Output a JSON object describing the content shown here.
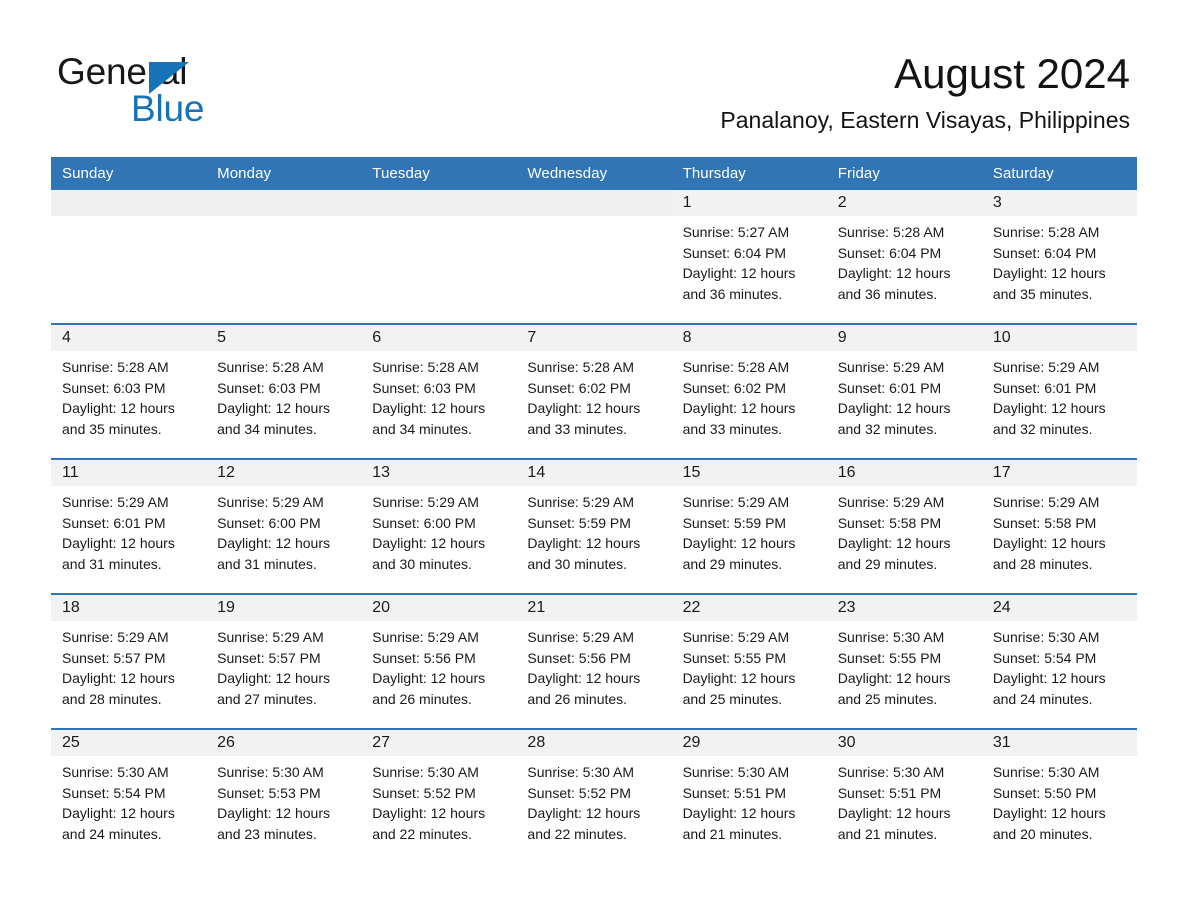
{
  "brand": {
    "name_part1": "General",
    "name_part2": "Blue",
    "flag_icon": "triangle-flag-icon",
    "accent_color": "#1773b8"
  },
  "header": {
    "month_title": "August 2024",
    "location": "Panalanoy, Eastern Visayas, Philippines"
  },
  "theme": {
    "header_blue": "#3275b4",
    "date_band_gray": "#f2f2f2",
    "text_color": "#1a1a1a"
  },
  "weekday_headers": [
    "Sunday",
    "Monday",
    "Tuesday",
    "Wednesday",
    "Thursday",
    "Friday",
    "Saturday"
  ],
  "labels": {
    "sunrise_prefix": "Sunrise: ",
    "sunset_prefix": "Sunset: ",
    "daylight_prefix": "Daylight: "
  },
  "weeks": [
    [
      {
        "date": "",
        "sunrise": "",
        "sunset": "",
        "daylight": ""
      },
      {
        "date": "",
        "sunrise": "",
        "sunset": "",
        "daylight": ""
      },
      {
        "date": "",
        "sunrise": "",
        "sunset": "",
        "daylight": ""
      },
      {
        "date": "",
        "sunrise": "",
        "sunset": "",
        "daylight": ""
      },
      {
        "date": "1",
        "sunrise": "Sunrise: 5:27 AM",
        "sunset": "Sunset: 6:04 PM",
        "daylight": "Daylight: 12 hours and 36 minutes."
      },
      {
        "date": "2",
        "sunrise": "Sunrise: 5:28 AM",
        "sunset": "Sunset: 6:04 PM",
        "daylight": "Daylight: 12 hours and 36 minutes."
      },
      {
        "date": "3",
        "sunrise": "Sunrise: 5:28 AM",
        "sunset": "Sunset: 6:04 PM",
        "daylight": "Daylight: 12 hours and 35 minutes."
      }
    ],
    [
      {
        "date": "4",
        "sunrise": "Sunrise: 5:28 AM",
        "sunset": "Sunset: 6:03 PM",
        "daylight": "Daylight: 12 hours and 35 minutes."
      },
      {
        "date": "5",
        "sunrise": "Sunrise: 5:28 AM",
        "sunset": "Sunset: 6:03 PM",
        "daylight": "Daylight: 12 hours and 34 minutes."
      },
      {
        "date": "6",
        "sunrise": "Sunrise: 5:28 AM",
        "sunset": "Sunset: 6:03 PM",
        "daylight": "Daylight: 12 hours and 34 minutes."
      },
      {
        "date": "7",
        "sunrise": "Sunrise: 5:28 AM",
        "sunset": "Sunset: 6:02 PM",
        "daylight": "Daylight: 12 hours and 33 minutes."
      },
      {
        "date": "8",
        "sunrise": "Sunrise: 5:28 AM",
        "sunset": "Sunset: 6:02 PM",
        "daylight": "Daylight: 12 hours and 33 minutes."
      },
      {
        "date": "9",
        "sunrise": "Sunrise: 5:29 AM",
        "sunset": "Sunset: 6:01 PM",
        "daylight": "Daylight: 12 hours and 32 minutes."
      },
      {
        "date": "10",
        "sunrise": "Sunrise: 5:29 AM",
        "sunset": "Sunset: 6:01 PM",
        "daylight": "Daylight: 12 hours and 32 minutes."
      }
    ],
    [
      {
        "date": "11",
        "sunrise": "Sunrise: 5:29 AM",
        "sunset": "Sunset: 6:01 PM",
        "daylight": "Daylight: 12 hours and 31 minutes."
      },
      {
        "date": "12",
        "sunrise": "Sunrise: 5:29 AM",
        "sunset": "Sunset: 6:00 PM",
        "daylight": "Daylight: 12 hours and 31 minutes."
      },
      {
        "date": "13",
        "sunrise": "Sunrise: 5:29 AM",
        "sunset": "Sunset: 6:00 PM",
        "daylight": "Daylight: 12 hours and 30 minutes."
      },
      {
        "date": "14",
        "sunrise": "Sunrise: 5:29 AM",
        "sunset": "Sunset: 5:59 PM",
        "daylight": "Daylight: 12 hours and 30 minutes."
      },
      {
        "date": "15",
        "sunrise": "Sunrise: 5:29 AM",
        "sunset": "Sunset: 5:59 PM",
        "daylight": "Daylight: 12 hours and 29 minutes."
      },
      {
        "date": "16",
        "sunrise": "Sunrise: 5:29 AM",
        "sunset": "Sunset: 5:58 PM",
        "daylight": "Daylight: 12 hours and 29 minutes."
      },
      {
        "date": "17",
        "sunrise": "Sunrise: 5:29 AM",
        "sunset": "Sunset: 5:58 PM",
        "daylight": "Daylight: 12 hours and 28 minutes."
      }
    ],
    [
      {
        "date": "18",
        "sunrise": "Sunrise: 5:29 AM",
        "sunset": "Sunset: 5:57 PM",
        "daylight": "Daylight: 12 hours and 28 minutes."
      },
      {
        "date": "19",
        "sunrise": "Sunrise: 5:29 AM",
        "sunset": "Sunset: 5:57 PM",
        "daylight": "Daylight: 12 hours and 27 minutes."
      },
      {
        "date": "20",
        "sunrise": "Sunrise: 5:29 AM",
        "sunset": "Sunset: 5:56 PM",
        "daylight": "Daylight: 12 hours and 26 minutes."
      },
      {
        "date": "21",
        "sunrise": "Sunrise: 5:29 AM",
        "sunset": "Sunset: 5:56 PM",
        "daylight": "Daylight: 12 hours and 26 minutes."
      },
      {
        "date": "22",
        "sunrise": "Sunrise: 5:29 AM",
        "sunset": "Sunset: 5:55 PM",
        "daylight": "Daylight: 12 hours and 25 minutes."
      },
      {
        "date": "23",
        "sunrise": "Sunrise: 5:30 AM",
        "sunset": "Sunset: 5:55 PM",
        "daylight": "Daylight: 12 hours and 25 minutes."
      },
      {
        "date": "24",
        "sunrise": "Sunrise: 5:30 AM",
        "sunset": "Sunset: 5:54 PM",
        "daylight": "Daylight: 12 hours and 24 minutes."
      }
    ],
    [
      {
        "date": "25",
        "sunrise": "Sunrise: 5:30 AM",
        "sunset": "Sunset: 5:54 PM",
        "daylight": "Daylight: 12 hours and 24 minutes."
      },
      {
        "date": "26",
        "sunrise": "Sunrise: 5:30 AM",
        "sunset": "Sunset: 5:53 PM",
        "daylight": "Daylight: 12 hours and 23 minutes."
      },
      {
        "date": "27",
        "sunrise": "Sunrise: 5:30 AM",
        "sunset": "Sunset: 5:52 PM",
        "daylight": "Daylight: 12 hours and 22 minutes."
      },
      {
        "date": "28",
        "sunrise": "Sunrise: 5:30 AM",
        "sunset": "Sunset: 5:52 PM",
        "daylight": "Daylight: 12 hours and 22 minutes."
      },
      {
        "date": "29",
        "sunrise": "Sunrise: 5:30 AM",
        "sunset": "Sunset: 5:51 PM",
        "daylight": "Daylight: 12 hours and 21 minutes."
      },
      {
        "date": "30",
        "sunrise": "Sunrise: 5:30 AM",
        "sunset": "Sunset: 5:51 PM",
        "daylight": "Daylight: 12 hours and 21 minutes."
      },
      {
        "date": "31",
        "sunrise": "Sunrise: 5:30 AM",
        "sunset": "Sunset: 5:50 PM",
        "daylight": "Daylight: 12 hours and 20 minutes."
      }
    ]
  ]
}
